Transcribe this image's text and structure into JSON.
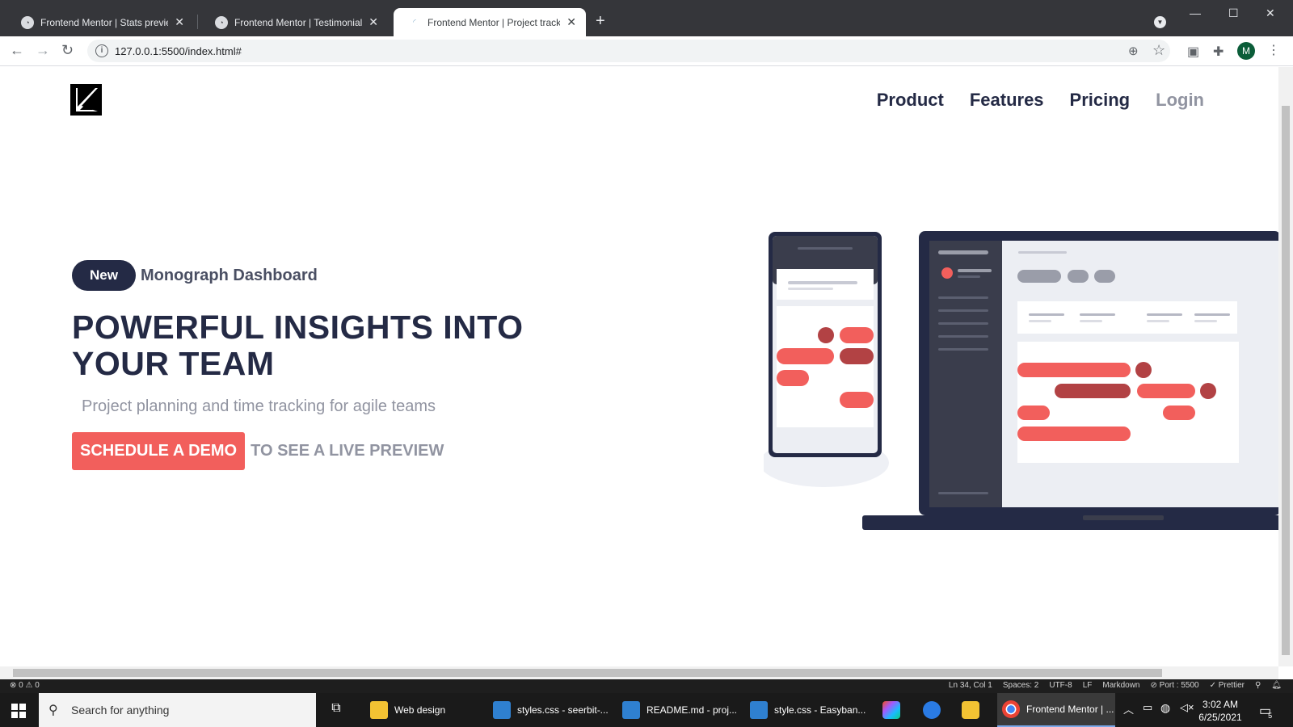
{
  "browser": {
    "tabs": [
      {
        "label": "Frontend Mentor | Stats preview",
        "active": false
      },
      {
        "label": "Frontend Mentor | Testimonial-g",
        "active": false
      },
      {
        "label": "Frontend Mentor | Project trackin",
        "active": true
      }
    ],
    "url": "127.0.0.1:5500/index.html#",
    "profile_initial": "M"
  },
  "page": {
    "nav": [
      "Product",
      "Features",
      "Pricing",
      "Login"
    ],
    "badge": "New",
    "badge_text": "Monograph Dashboard",
    "headline": "POWERFUL INSIGHTS INTO YOUR TEAM",
    "subtext": "Project planning and time tracking for agile teams",
    "cta_button": "SCHEDULE A DEMO",
    "cta_text": "TO SEE A LIVE PREVIEW",
    "colors": {
      "navy": "#242a45",
      "grey": "#9194a1",
      "red": "#f25f5c",
      "dark_red": "#b24244"
    }
  },
  "statusbar": {
    "problems": "⊗ 0 ⚠ 0",
    "position": "Ln 34, Col 1",
    "spaces": "Spaces: 2",
    "encoding": "UTF-8",
    "eol": "LF",
    "language": "Markdown",
    "port": "⊘ Port : 5500",
    "prettier": "✓ Prettier"
  },
  "taskbar": {
    "search_placeholder": "Search for anything",
    "items": [
      "Web design",
      "styles.css - seerbit-...",
      "README.md - proj...",
      "style.css - Easyban...",
      "Frontend Mentor | ..."
    ],
    "time": "3:02 AM",
    "date": "6/25/2021",
    "notification_count": "5"
  }
}
